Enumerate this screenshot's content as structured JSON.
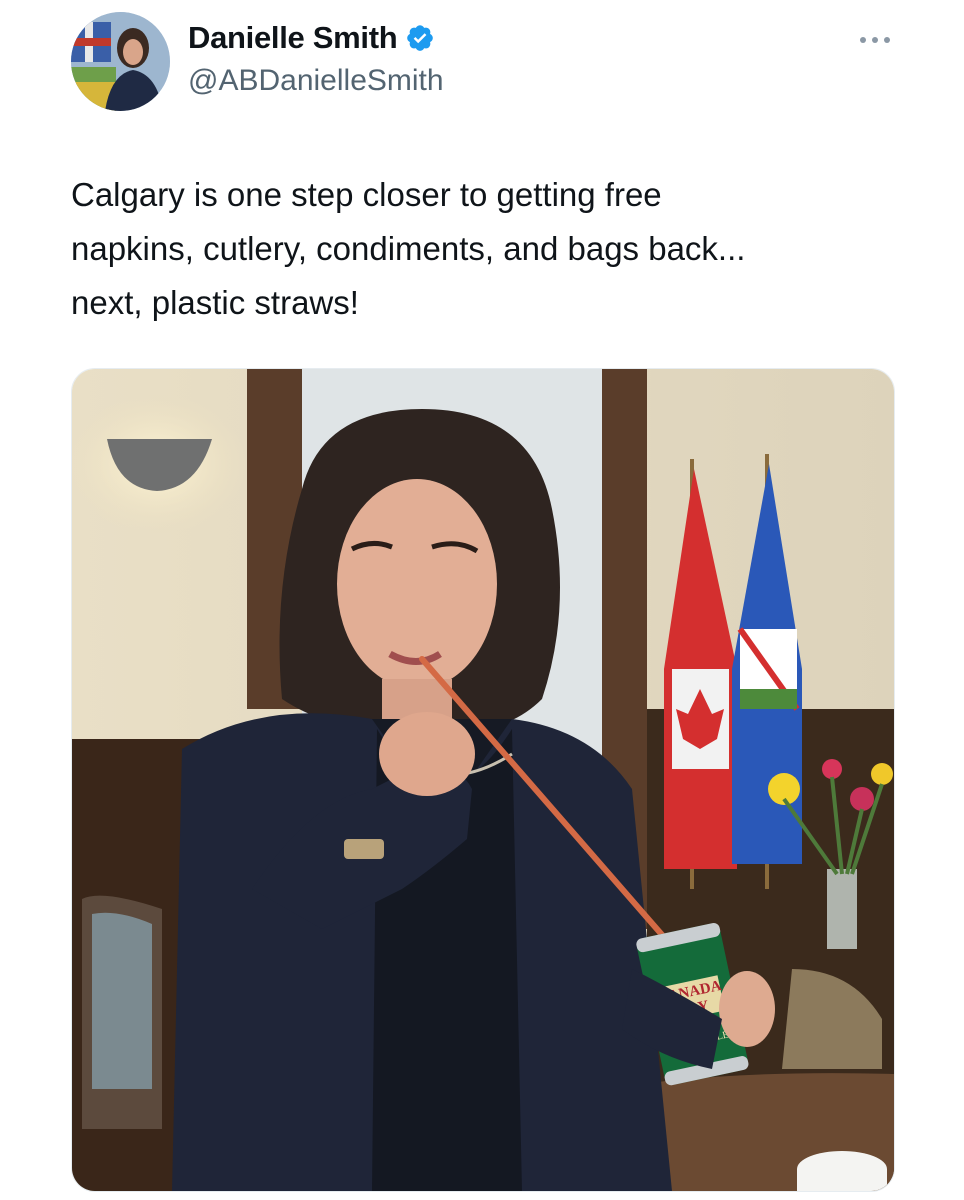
{
  "author": {
    "display_name": "Danielle Smith",
    "handle": "@ABDanielleSmith",
    "verified": true,
    "avatar_icon": "profile-photo",
    "verified_icon": "verified-badge-icon"
  },
  "menu": {
    "icon": "more-options-icon"
  },
  "tweet": {
    "text": "Calgary is one step closer to getting free\nnapkins, cutlery, condiments, and bags back...\nnext, plastic straws!"
  },
  "media": {
    "can": {
      "brand_line1": "CANADA",
      "brand_line2": "DRY",
      "product": "GINGER ALE"
    }
  },
  "colors": {
    "text_primary": "#0f1419",
    "text_secondary": "#536471",
    "verified_blue": "#1d9bf0",
    "more_dots": "#8b98a5"
  }
}
